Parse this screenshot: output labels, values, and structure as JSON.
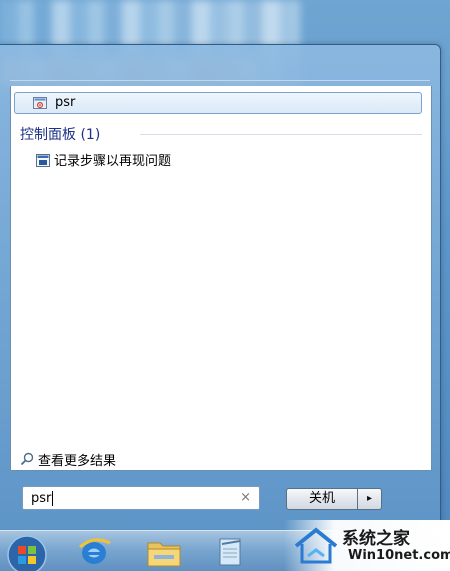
{
  "search_results": {
    "programs": [
      {
        "label": "psr",
        "icon": "psr-program-icon"
      }
    ],
    "control_panel": {
      "header": "控制面板 (1)",
      "items": [
        {
          "label": "记录步骤以再现问题",
          "icon": "steps-recorder-icon"
        }
      ]
    },
    "see_more": {
      "label": "查看更多结果",
      "icon": "search-icon"
    }
  },
  "search_box": {
    "value": "psr",
    "clear_glyph": "×"
  },
  "shutdown": {
    "label": "关机",
    "arrow_glyph": "▸"
  },
  "taskbar": {
    "items": [
      {
        "name": "start-orb",
        "icon": "windows-orb-icon"
      },
      {
        "name": "internet-explorer",
        "icon": "ie-icon"
      },
      {
        "name": "windows-explorer",
        "icon": "folder-icon"
      },
      {
        "name": "app",
        "icon": "notepad-icon"
      }
    ]
  },
  "watermark": {
    "title": "系统之家",
    "subtitle": "Win10net.com"
  },
  "colors": {
    "section_header": "#1e3287",
    "highlight_border": "#7da2ce"
  }
}
